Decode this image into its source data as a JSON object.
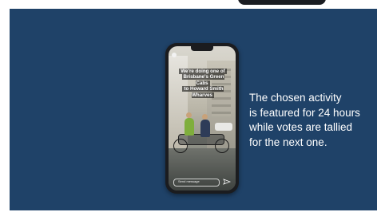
{
  "slide": {
    "description_lines": [
      "The chosen activity",
      "is featured for 24 hours",
      "while votes are tallied",
      "for the next one."
    ]
  },
  "phone": {
    "caption_lines": [
      "We're doing one of",
      "Brisbane's Green Cabs",
      "to Howard Smith Wharves"
    ],
    "reply_placeholder": "Send message",
    "icons": [
      "story-avatar-icon",
      "send-icon"
    ]
  },
  "colors": {
    "slide_background": "#1f4268",
    "text": "#ffffff",
    "rider_jacket": "#7fae3c"
  }
}
